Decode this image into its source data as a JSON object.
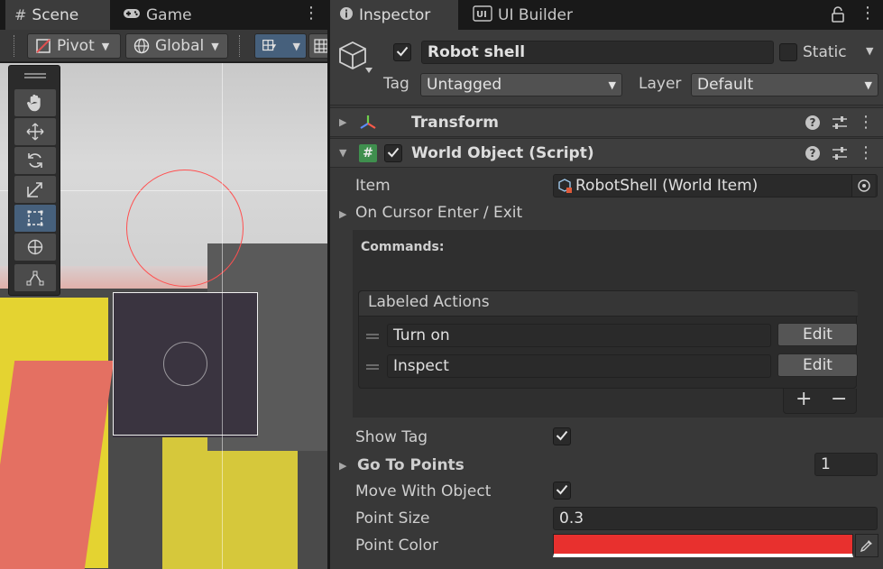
{
  "scene_tabs": [
    {
      "label": "Scene",
      "icon": "hash-icon",
      "active": true
    },
    {
      "label": "Game",
      "icon": "gamepad-icon",
      "active": false
    }
  ],
  "scene_toolbar": {
    "pivot": "Pivot",
    "global": "Global"
  },
  "inspector_tabs": [
    {
      "label": "Inspector",
      "icon": "info-icon",
      "active": true
    },
    {
      "label": "UI Builder",
      "icon": "ui-builder-icon",
      "active": false
    }
  ],
  "object": {
    "name": "Robot shell",
    "active": true,
    "static_label": "Static",
    "tag_label": "Tag",
    "tag_value": "Untagged",
    "layer_label": "Layer",
    "layer_value": "Default"
  },
  "components": {
    "transform": "Transform",
    "world_object": "World Object (Script)"
  },
  "world_object": {
    "item_label": "Item",
    "item_value": "RobotShell (World Item)",
    "on_cursor": "On Cursor Enter / Exit",
    "commands_label": "Commands:",
    "labeled_actions_title": "Labeled Actions",
    "actions": [
      {
        "name": "Turn on",
        "button": "Edit"
      },
      {
        "name": "Inspect",
        "button": "Edit"
      }
    ],
    "add_label": "+",
    "remove_label": "−",
    "show_tag_label": "Show Tag",
    "show_tag": true,
    "go_to_points_label": "Go To Points",
    "go_to_points_count": "1",
    "move_with_object_label": "Move With Object",
    "move_with_object": true,
    "point_size_label": "Point Size",
    "point_size": "0.3",
    "point_color_label": "Point Color",
    "point_color": "#e8302e"
  },
  "colors": {
    "accent_selected": "#46607c",
    "panel_bg": "#383838"
  }
}
